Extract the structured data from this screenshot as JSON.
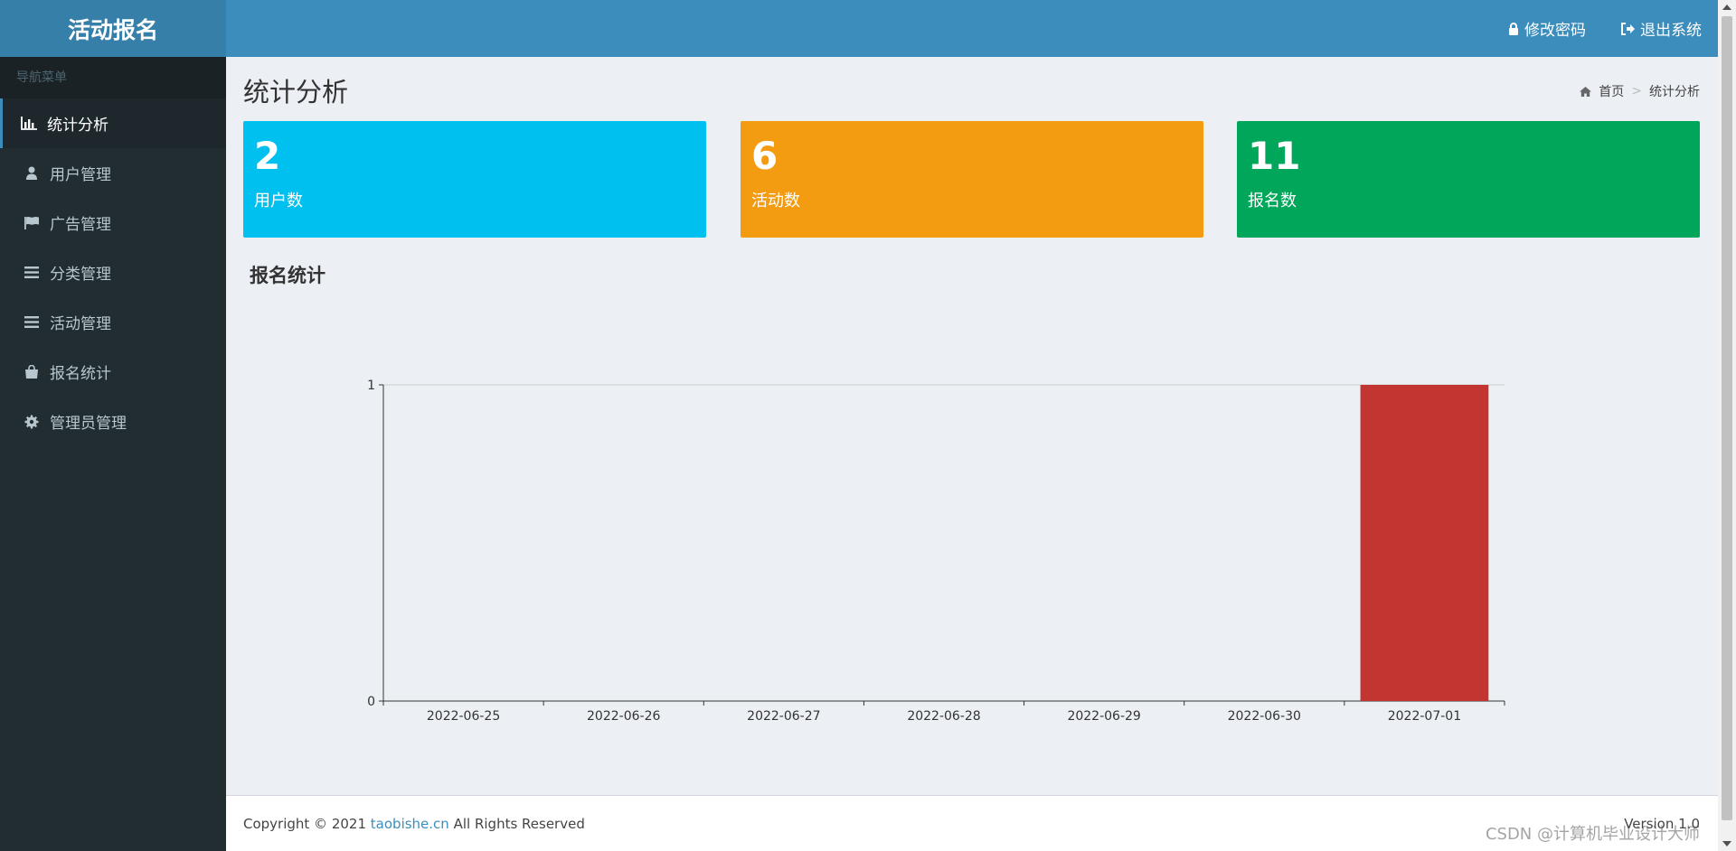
{
  "header": {
    "logo": "活动报名",
    "change_password": "修改密码",
    "logout": "退出系统"
  },
  "sidebar": {
    "menu_header": "导航菜单",
    "items": [
      {
        "label": "统计分析",
        "icon": "bar-chart-icon",
        "active": true
      },
      {
        "label": "用户管理",
        "icon": "user-icon"
      },
      {
        "label": "广告管理",
        "icon": "flag-icon"
      },
      {
        "label": "分类管理",
        "icon": "list-icon"
      },
      {
        "label": "活动管理",
        "icon": "list-icon"
      },
      {
        "label": "报名统计",
        "icon": "shopping-bag-icon"
      },
      {
        "label": "管理员管理",
        "icon": "gear-icon"
      }
    ]
  },
  "main": {
    "page_title": "统计分析",
    "breadcrumb": {
      "home": "首页",
      "separator": ">",
      "current": "统计分析"
    },
    "stats": [
      {
        "value": "2",
        "label": "用户数",
        "color": "#00c0ef"
      },
      {
        "value": "6",
        "label": "活动数",
        "color": "#f39c12"
      },
      {
        "value": "11",
        "label": "报名数",
        "color": "#00a65a"
      }
    ],
    "chart_heading": "报名统计"
  },
  "chart_data": {
    "type": "bar",
    "categories": [
      "2022-06-25",
      "2022-06-26",
      "2022-06-27",
      "2022-06-28",
      "2022-06-29",
      "2022-06-30",
      "2022-07-01"
    ],
    "values": [
      0,
      0,
      0,
      0,
      0,
      0,
      1
    ],
    "ylim": [
      0,
      1
    ],
    "yticks": [
      0,
      1
    ],
    "bar_color": "#c23531",
    "grid": true
  },
  "footer": {
    "copyright_prefix": "Copyright © 2021",
    "link": "taobishe.cn",
    "copyright_suffix": "All Rights Reserved",
    "version": "Version 1.0"
  },
  "watermark": "CSDN @计算机毕业设计大师"
}
